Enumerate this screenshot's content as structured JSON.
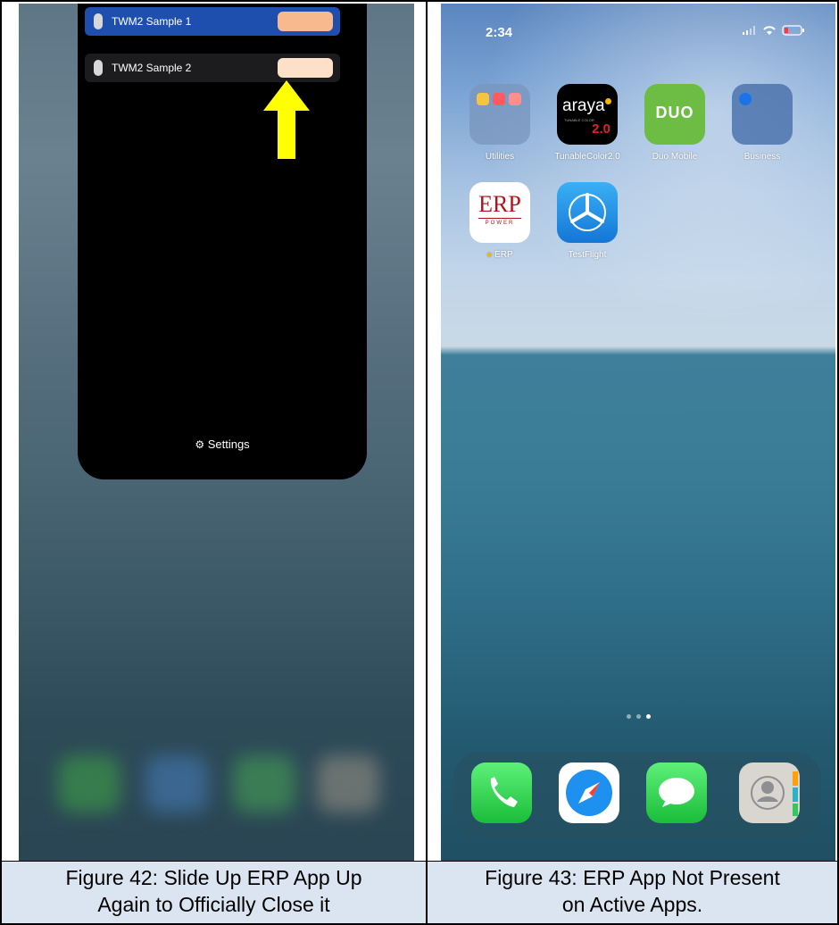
{
  "left_panel": {
    "widgets": [
      {
        "label": "TWM2 Sample 1",
        "swatch_color": "#f8b98f",
        "row_color": "#1f4fae"
      },
      {
        "label": "TWM2 Sample 2",
        "swatch_color": "#fde0c8",
        "row_color": "#1c1c1e"
      }
    ],
    "settings_label": "Settings",
    "arrow_color": "#ffff00"
  },
  "right_panel": {
    "status_time": "2:34",
    "apps": [
      {
        "name": "Utilities"
      },
      {
        "name": "TunableColor2.0",
        "icon_text": "araya",
        "icon_subtext": "TUNABLE COLOR",
        "icon_version": "2.0"
      },
      {
        "name": "Duo Mobile",
        "icon_text": "DUO"
      },
      {
        "name": "Business"
      },
      {
        "name": "ERP",
        "icon_text": "ERP",
        "icon_subtext": "POWER"
      },
      {
        "name": "TestFlight"
      }
    ],
    "dock": [
      "phone-icon",
      "safari-icon",
      "messages-icon",
      "contacts-icon"
    ]
  },
  "captions": {
    "fig42_line1": "Figure 42: Slide Up ERP App Up",
    "fig42_line2": "Again to Officially Close it",
    "fig43_line1": "Figure 43: ERP App Not Present",
    "fig43_line2": "on Active Apps."
  }
}
